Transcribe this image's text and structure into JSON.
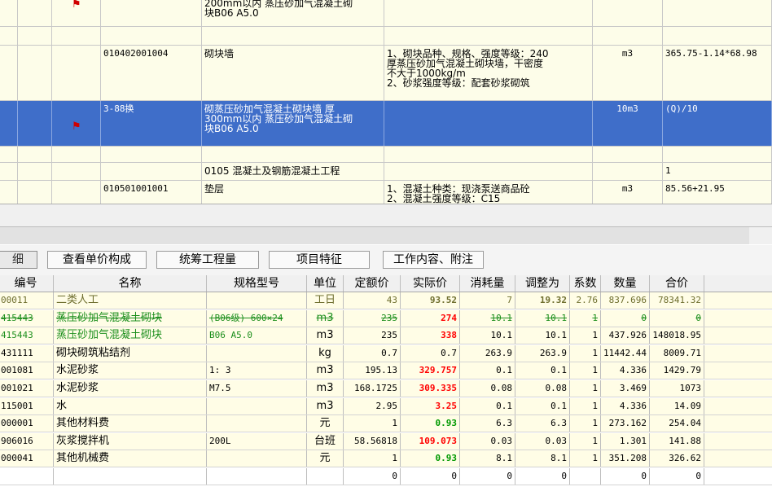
{
  "upper_rows": [
    {
      "code": "",
      "name": "200mm以内 蒸压砂加气混凝土砌\n块B06 A5.0",
      "feature": "",
      "unit": "",
      "expr": "",
      "flag": true,
      "selected": false
    },
    {
      "code": "",
      "name": "",
      "feature": "",
      "unit": "",
      "expr": "",
      "flag": false,
      "selected": false
    },
    {
      "code": "010402001004",
      "name": "砌块墙",
      "feature": "1、砌块品种、规格、强度等级：240\n厚蒸压砂加气混凝土砌块墙，干密度\n不大于1000kg/m\n2、砂浆强度等级：配套砂浆砌筑",
      "unit": "m3",
      "expr": "365.75-1.14*68.98",
      "flag": false,
      "selected": false
    },
    {
      "code": "3-88换",
      "name": "砌蒸压砂加气混凝土砌块墙 厚\n300mm以内 蒸压砂加气混凝土砌\n块B06 A5.0",
      "feature": "",
      "unit": "10m3",
      "expr": "(Q)/10",
      "flag": true,
      "selected": true
    },
    {
      "code": "",
      "name": "",
      "feature": "",
      "unit": "",
      "expr": "",
      "flag": false,
      "selected": false
    },
    {
      "code": "",
      "name": "0105 混凝土及钢筋混凝土工程",
      "feature": "",
      "unit": "",
      "expr": "1",
      "flag": false,
      "selected": false
    },
    {
      "code": "010501001001",
      "name": "垫层",
      "feature": "1、混凝土种类：现浇泵送商品砼\n2、混凝土强度等级：C15",
      "unit": "m3",
      "expr": "85.56+21.95",
      "flag": false,
      "selected": false
    }
  ],
  "tabs": [
    "细",
    "查看单价构成",
    "统筹工程量",
    "项目特征",
    "工作内容、附注"
  ],
  "grid_headers": [
    "编号",
    "名称",
    "规格型号",
    "单位",
    "定额价",
    "实际价",
    "消耗量",
    "调整为",
    "系数",
    "数量",
    "合价"
  ],
  "grid_rows": [
    {
      "code": "00011",
      "name": "二类人工",
      "spec": "",
      "unit": "工日",
      "base": "43",
      "actual": "93.52",
      "consume": "7",
      "adjust": "19.32",
      "coef": "2.76",
      "qty": "837.696",
      "total": "78341.32",
      "style": "olive"
    },
    {
      "code": "415443",
      "name": "蒸压砂加气混凝土砌块",
      "spec": "(B06级) 600×24",
      "unit": "m3",
      "base": "235",
      "actual": "274",
      "consume": "10.1",
      "adjust": "10.1",
      "coef": "1",
      "qty": "0",
      "total": "0",
      "style": "strike"
    },
    {
      "code": "415443",
      "name": "蒸压砂加气混凝土砌块",
      "spec": "B06 A5.0",
      "unit": "m3",
      "base": "235",
      "actual": "338",
      "consume": "10.1",
      "adjust": "10.1",
      "coef": "1",
      "qty": "437.926",
      "total": "148018.95",
      "style": "green"
    },
    {
      "code": "431111",
      "name": "砌块砌筑粘结剂",
      "spec": "",
      "unit": "kg",
      "base": "0.7",
      "actual": "0.7",
      "consume": "263.9",
      "adjust": "263.9",
      "coef": "1",
      "qty": "11442.44",
      "total": "8009.71",
      "style": "normal"
    },
    {
      "code": "001081",
      "name": "水泥砂浆",
      "spec": "1: 3",
      "unit": "m3",
      "base": "195.13",
      "actual": "329.757",
      "consume": "0.1",
      "adjust": "0.1",
      "coef": "1",
      "qty": "4.336",
      "total": "1429.79",
      "style": "normal"
    },
    {
      "code": "001021",
      "name": "水泥砂浆",
      "spec": "M7.5",
      "unit": "m3",
      "base": "168.1725",
      "actual": "309.335",
      "consume": "0.08",
      "adjust": "0.08",
      "coef": "1",
      "qty": "3.469",
      "total": "1073",
      "style": "normal"
    },
    {
      "code": "115001",
      "name": "水",
      "spec": "",
      "unit": "m3",
      "base": "2.95",
      "actual": "3.25",
      "consume": "0.1",
      "adjust": "0.1",
      "coef": "1",
      "qty": "4.336",
      "total": "14.09",
      "style": "normal"
    },
    {
      "code": "000001",
      "name": "其他材料费",
      "spec": "",
      "unit": "元",
      "base": "1",
      "actual": "0.93",
      "consume": "6.3",
      "adjust": "6.3",
      "coef": "1",
      "qty": "273.162",
      "total": "254.04",
      "style": "normal"
    },
    {
      "code": "906016",
      "name": "灰浆搅拌机",
      "spec": "200L",
      "unit": "台班",
      "base": "58.56818",
      "actual": "109.073",
      "consume": "0.03",
      "adjust": "0.03",
      "coef": "1",
      "qty": "1.301",
      "total": "141.88",
      "style": "normal"
    },
    {
      "code": "000041",
      "name": "其他机械费",
      "spec": "",
      "unit": "元",
      "base": "1",
      "actual": "0.93",
      "consume": "8.1",
      "adjust": "8.1",
      "coef": "1",
      "qty": "351.208",
      "total": "326.62",
      "style": "normal"
    },
    {
      "code": "",
      "name": "",
      "spec": "",
      "unit": "",
      "base": "0",
      "actual": "0",
      "consume": "0",
      "adjust": "0",
      "coef": "",
      "qty": "0",
      "total": "0",
      "style": "empty"
    }
  ],
  "colors": {
    "selected_row": "#3f6ec9",
    "price_red": "#ff0000",
    "price_green": "#009900",
    "material_green": "#1d8f1d",
    "row_bg": "#fffde6"
  }
}
